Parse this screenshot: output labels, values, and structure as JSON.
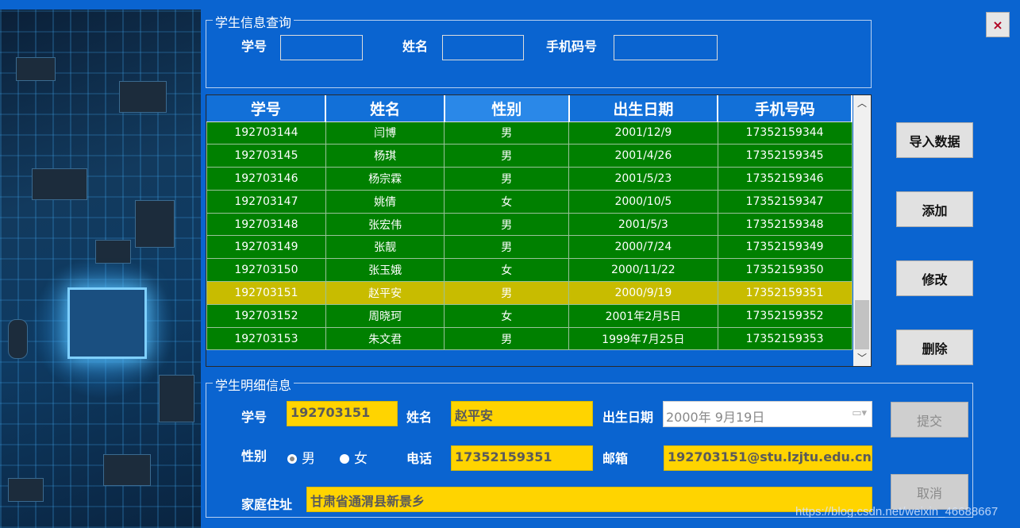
{
  "query": {
    "legend": "学生信息查询",
    "id_label": "学号",
    "name_label": "姓名",
    "phone_label": "手机码号"
  },
  "grid": {
    "columns": [
      "学号",
      "姓名",
      "性别",
      "出生日期",
      "手机号码"
    ],
    "rows": [
      [
        "192703144",
        "闫博",
        "男",
        "2001/12/9",
        "17352159344"
      ],
      [
        "192703145",
        "杨琪",
        "男",
        "2001/4/26",
        "17352159345"
      ],
      [
        "192703146",
        "杨宗霖",
        "男",
        "2001/5/23",
        "17352159346"
      ],
      [
        "192703147",
        "姚倩",
        "女",
        "2000/10/5",
        "17352159347"
      ],
      [
        "192703148",
        "张宏伟",
        "男",
        "2001/5/3",
        "17352159348"
      ],
      [
        "192703149",
        "张靓",
        "男",
        "2000/7/24",
        "17352159349"
      ],
      [
        "192703150",
        "张玉娥",
        "女",
        "2000/11/22",
        "17352159350"
      ],
      [
        "192703151",
        "赵平安",
        "男",
        "2000/9/19",
        "17352159351"
      ],
      [
        "192703152",
        "周晓珂",
        "女",
        "2001年2月5日",
        "17352159352"
      ],
      [
        "192703153",
        "朱文君",
        "男",
        "1999年7月25日",
        "17352159353"
      ]
    ],
    "highlighted_row": 7
  },
  "actions": {
    "import": "导入数据",
    "add": "添加",
    "edit": "修改",
    "delete": "删除"
  },
  "detail": {
    "legend": "学生明细信息",
    "id_label": "学号",
    "id_value": "192703151",
    "name_label": "姓名",
    "name_value": "赵平安",
    "birth_label": "出生日期",
    "birth_value": "2000年  9月19日",
    "gender_label": "性别",
    "gender_male": "男",
    "gender_female": "女",
    "gender_selected": "男",
    "phone_label": "电话",
    "phone_value": "17352159351",
    "email_label": "邮箱",
    "email_value": "192703151@stu.lzjtu.edu.cn",
    "address_label": "家庭住址",
    "address_value": "甘肃省通渭县新景乡",
    "submit": "提交",
    "cancel": "取消"
  },
  "close_label": "×",
  "watermark": "https://blog.csdn.net/weixin_46688667",
  "colors": {
    "background": "#0a64d0",
    "row_green": "#008000",
    "row_highlight": "#c8bc00",
    "field_yellow": "#ffd400"
  }
}
